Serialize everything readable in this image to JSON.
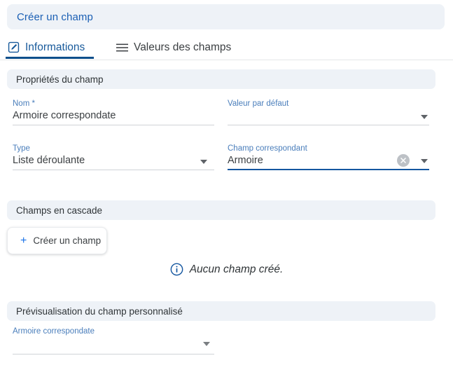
{
  "header": {
    "title": "Créer un champ"
  },
  "tabs": [
    {
      "label": "Informations",
      "icon": "edit-square-icon",
      "active": true
    },
    {
      "label": "Valeurs des champs",
      "icon": "hamburger-icon",
      "active": false
    }
  ],
  "sections": {
    "properties": {
      "title": "Propriétés du champ"
    },
    "cascade": {
      "title": "Champs en cascade"
    },
    "preview": {
      "title": "Prévisualisation du champ personnalisé"
    }
  },
  "form": {
    "nom": {
      "label": "Nom *",
      "value": "Armoire correspondate"
    },
    "valeur_defaut": {
      "label": "Valeur par défaut",
      "value": ""
    },
    "type": {
      "label": "Type",
      "value": "Liste déroulante"
    },
    "champ_correspondant": {
      "label": "Champ correspondant",
      "value": "Armoire"
    }
  },
  "cascade": {
    "create_button": {
      "label": "Créer un champ",
      "icon": "plus-icon"
    },
    "empty_message": "Aucun champ créé.",
    "empty_icon": "info-circle-icon"
  },
  "preview": {
    "field_label": "Armoire correspondate",
    "field_value": ""
  },
  "colors": {
    "title_text": "#1a5fb4",
    "section_bg": "#eef2f7",
    "tab_active": "#0d4f8b",
    "field_label": "#4a7ebb",
    "focus_underline": "#1557a0",
    "accent_plus": "#1a73e8"
  }
}
